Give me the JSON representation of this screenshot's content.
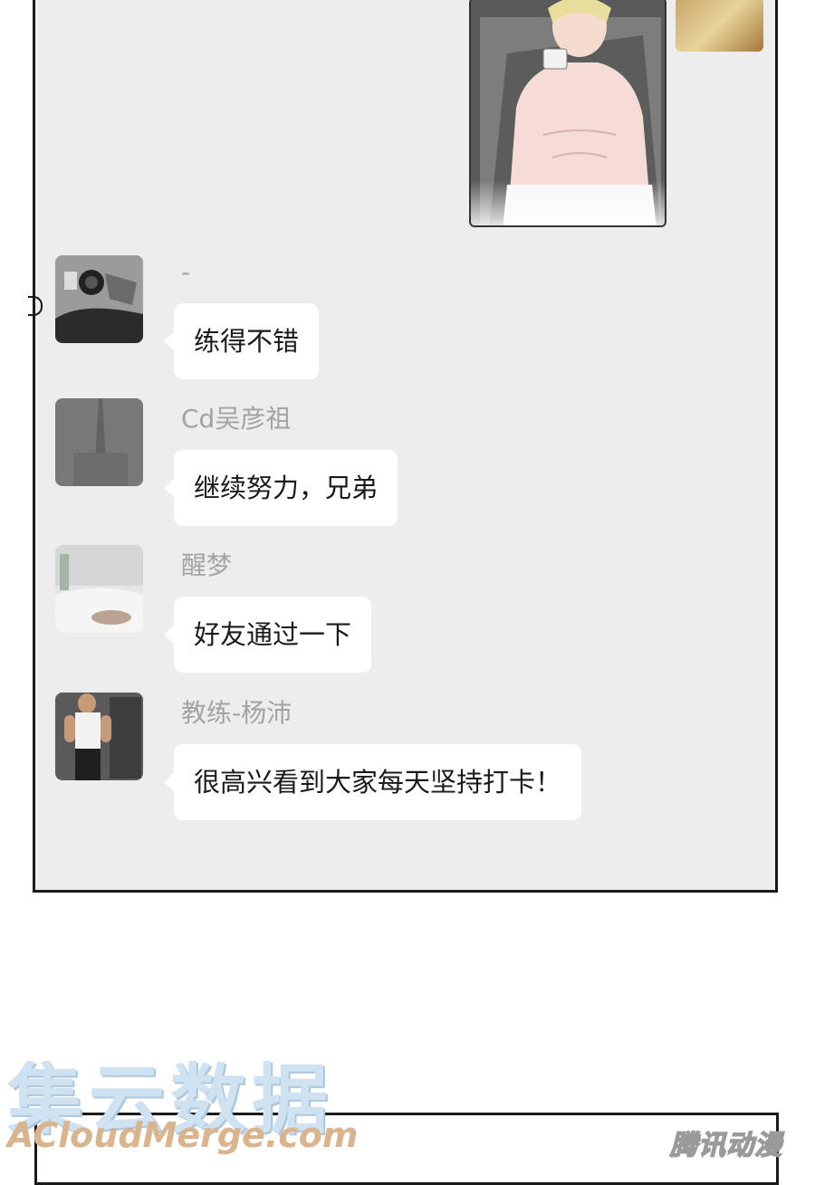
{
  "chat": {
    "messages": [
      {
        "sender": "-",
        "text": "练得不错",
        "avatar": "camera-photo-avatar"
      },
      {
        "sender": "Cd吴彦祖",
        "text": "继续努力，兄弟",
        "avatar": "tower-fog-avatar"
      },
      {
        "sender": "醒梦",
        "text": "好友通过一下",
        "avatar": "bedroom-avatar"
      },
      {
        "sender": "教练-杨沛",
        "text": "很高兴看到大家每天坚持打卡！",
        "avatar": "gym-avatar"
      }
    ]
  },
  "watermark": {
    "cn": "集云数据",
    "en": "ACloudMerge.com",
    "logo": "腾讯动漫"
  }
}
